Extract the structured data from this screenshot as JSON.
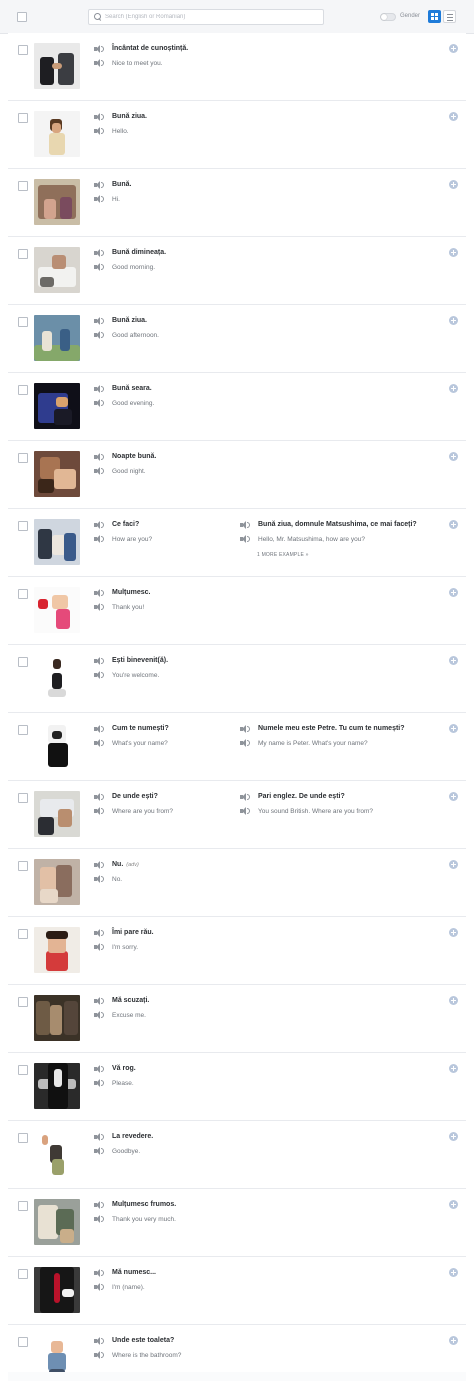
{
  "toolbar": {
    "search_placeholder": "Search (English or Romanian)",
    "gender_label": "Gender",
    "accent_color": "#1e7bd9"
  },
  "icons": {
    "speaker": "speaker-icon",
    "add": "plus-circle-icon",
    "search": "search-icon",
    "grid_view": "grid-view-icon",
    "list_view": "list-view-icon"
  },
  "phrases": [
    {
      "ro": "Încântat de cunoștință.",
      "en": "Nice to meet you."
    },
    {
      "ro": "Bună ziua.",
      "en": "Hello."
    },
    {
      "ro": "Bună.",
      "en": "Hi."
    },
    {
      "ro": "Bună dimineața.",
      "en": "Good morning."
    },
    {
      "ro": "Bună ziua.",
      "en": "Good afternoon."
    },
    {
      "ro": "Bună seara.",
      "en": "Good evening."
    },
    {
      "ro": "Noapte bună.",
      "en": "Good night."
    },
    {
      "ro": "Ce faci?",
      "en": "How are you?",
      "example": {
        "ro": "Bună ziua, domnule Matsushima, ce mai faceți?",
        "en": "Hello, Mr. Matsushima, how are you?"
      },
      "more": "1 MORE EXAMPLE »"
    },
    {
      "ro": "Mulțumesc.",
      "en": "Thank you!"
    },
    {
      "ro": "Ești binevenit(ă).",
      "en": "You're welcome."
    },
    {
      "ro": "Cum te numești?",
      "en": "What's your name?",
      "example": {
        "ro": "Numele meu este Petre. Tu cum te numești?",
        "en": "My name is Peter. What's your name?"
      }
    },
    {
      "ro": "De unde ești?",
      "en": "Where are you from?",
      "example": {
        "ro": "Pari englez. De unde ești?",
        "en": "You sound British. Where are you from?"
      }
    },
    {
      "ro": "Nu.",
      "note": "(adv)",
      "en": "No."
    },
    {
      "ro": "Îmi pare rău.",
      "en": "I'm sorry."
    },
    {
      "ro": "Mă scuzați.",
      "en": "Excuse me."
    },
    {
      "ro": "Vă rog.",
      "en": "Please."
    },
    {
      "ro": "La revedere.",
      "en": "Goodbye."
    },
    {
      "ro": "Mulțumesc frumos.",
      "en": "Thank you very much."
    },
    {
      "ro": "Mă numesc...",
      "en": "I'm (name)."
    },
    {
      "ro": "Unde este toaleta?",
      "en": "Where is the bathroom?"
    }
  ]
}
